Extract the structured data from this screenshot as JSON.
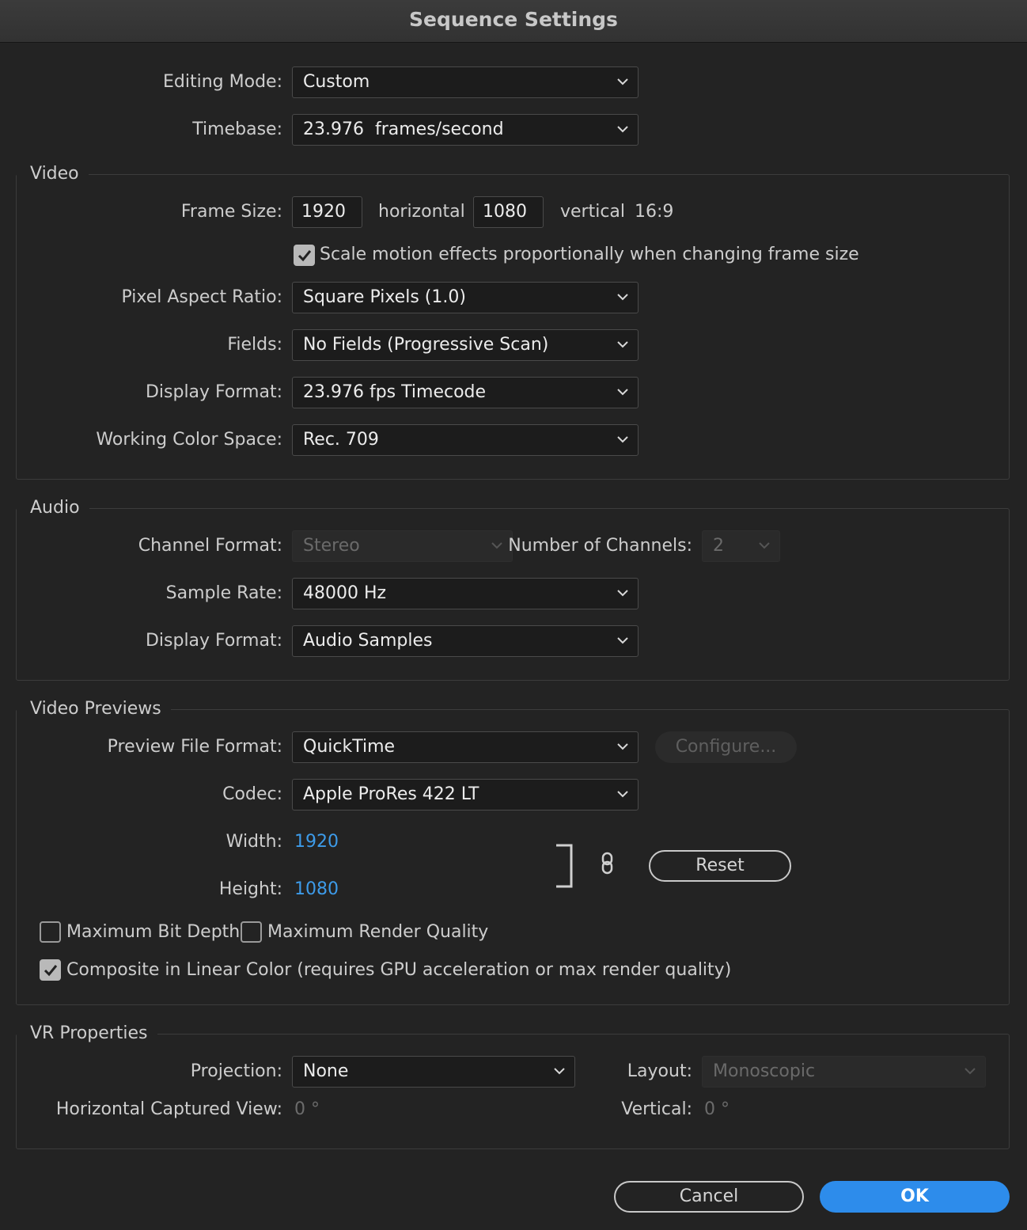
{
  "window": {
    "title": "Sequence Settings"
  },
  "general": {
    "editing_mode_label": "Editing Mode:",
    "editing_mode_value": "Custom",
    "timebase_label": "Timebase:",
    "timebase_value": "23.976  frames/second"
  },
  "video": {
    "group_title": "Video",
    "frame_size_label": "Frame Size:",
    "frame_width": "1920",
    "horizontal_label": "horizontal",
    "frame_height": "1080",
    "vertical_label": "vertical",
    "aspect": "16:9",
    "scale_motion_label": "Scale motion effects proportionally when changing frame size",
    "scale_motion_checked": true,
    "pixel_aspect_label": "Pixel Aspect Ratio:",
    "pixel_aspect_value": "Square Pixels (1.0)",
    "fields_label": "Fields:",
    "fields_value": "No Fields (Progressive Scan)",
    "display_format_label": "Display Format:",
    "display_format_value": "23.976 fps Timecode",
    "color_space_label": "Working Color Space:",
    "color_space_value": "Rec. 709"
  },
  "audio": {
    "group_title": "Audio",
    "channel_format_label": "Channel Format:",
    "channel_format_value": "Stereo",
    "num_channels_label": "Number of Channels:",
    "num_channels_value": "2",
    "sample_rate_label": "Sample Rate:",
    "sample_rate_value": "48000 Hz",
    "display_format_label": "Display Format:",
    "display_format_value": "Audio Samples"
  },
  "previews": {
    "group_title": "Video Previews",
    "file_format_label": "Preview File Format:",
    "file_format_value": "QuickTime",
    "configure_label": "Configure...",
    "codec_label": "Codec:",
    "codec_value": "Apple ProRes 422 LT",
    "width_label": "Width:",
    "width_value": "1920",
    "height_label": "Height:",
    "height_value": "1080",
    "reset_label": "Reset",
    "max_bit_depth_label": "Maximum Bit Depth",
    "max_bit_depth_checked": false,
    "max_render_quality_label": "Maximum Render Quality",
    "max_render_quality_checked": false,
    "linear_color_label": "Composite in Linear Color (requires GPU acceleration or max render quality)",
    "linear_color_checked": true
  },
  "vr": {
    "group_title": "VR Properties",
    "projection_label": "Projection:",
    "projection_value": "None",
    "layout_label": "Layout:",
    "layout_value": "Monoscopic",
    "h_view_label": "Horizontal Captured View:",
    "h_view_value": "0 °",
    "vertical_label": "Vertical:",
    "vertical_value": "0 °"
  },
  "footer": {
    "cancel_label": "Cancel",
    "ok_label": "OK"
  },
  "colors": {
    "accent": "#2d8ceb",
    "link": "#3d9be9",
    "background": "#232323"
  },
  "icons": [
    "chevron-down-icon",
    "checkmark-icon",
    "link-icon",
    "bracket-icon"
  ]
}
